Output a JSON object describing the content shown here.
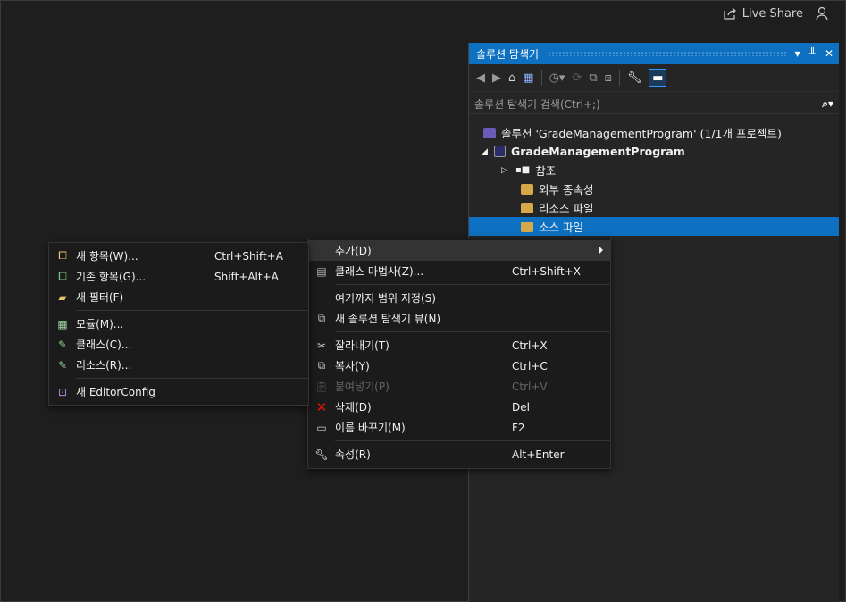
{
  "topbar": {
    "live_share": "Live Share"
  },
  "solution_explorer": {
    "title": "솔루션 탐색기",
    "search_placeholder": "솔루션 탐색기 검색(Ctrl+;)",
    "tree": {
      "solution": "솔루션 'GradeManagementProgram' (1/1개 프로젝트)",
      "project": "GradeManagementProgram",
      "references": "참조",
      "external_deps": "외부 종속성",
      "resource_files": "리소스 파일",
      "source_files": "소스 파일"
    }
  },
  "main_menu": {
    "items": [
      {
        "label": "추가(D)",
        "shortcut": ""
      },
      {
        "label": "클래스 마법사(Z)...",
        "shortcut": "Ctrl+Shift+X"
      },
      {
        "label": "여기까지 범위 지정(S)",
        "shortcut": ""
      },
      {
        "label": "새 솔루션 탐색기 뷰(N)",
        "shortcut": ""
      },
      {
        "label": "잘라내기(T)",
        "shortcut": "Ctrl+X"
      },
      {
        "label": "복사(Y)",
        "shortcut": "Ctrl+C"
      },
      {
        "label": "붙여넣기(P)",
        "shortcut": "Ctrl+V"
      },
      {
        "label": "삭제(D)",
        "shortcut": "Del"
      },
      {
        "label": "이름 바꾸기(M)",
        "shortcut": "F2"
      },
      {
        "label": "속성(R)",
        "shortcut": "Alt+Enter"
      }
    ]
  },
  "add_submenu": {
    "items": [
      {
        "label": "새 항목(W)...",
        "shortcut": "Ctrl+Shift+A"
      },
      {
        "label": "기존 항목(G)...",
        "shortcut": "Shift+Alt+A"
      },
      {
        "label": "새 필터(F)",
        "shortcut": ""
      },
      {
        "label": "모듈(M)...",
        "shortcut": ""
      },
      {
        "label": "클래스(C)...",
        "shortcut": ""
      },
      {
        "label": "리소스(R)...",
        "shortcut": ""
      },
      {
        "label": "새 EditorConfig",
        "shortcut": ""
      }
    ]
  },
  "colors": {
    "accent": "#0e70c0",
    "background": "#1e1e1e",
    "menu_bg": "#1b1b1c",
    "delete_red": "#e51400"
  }
}
